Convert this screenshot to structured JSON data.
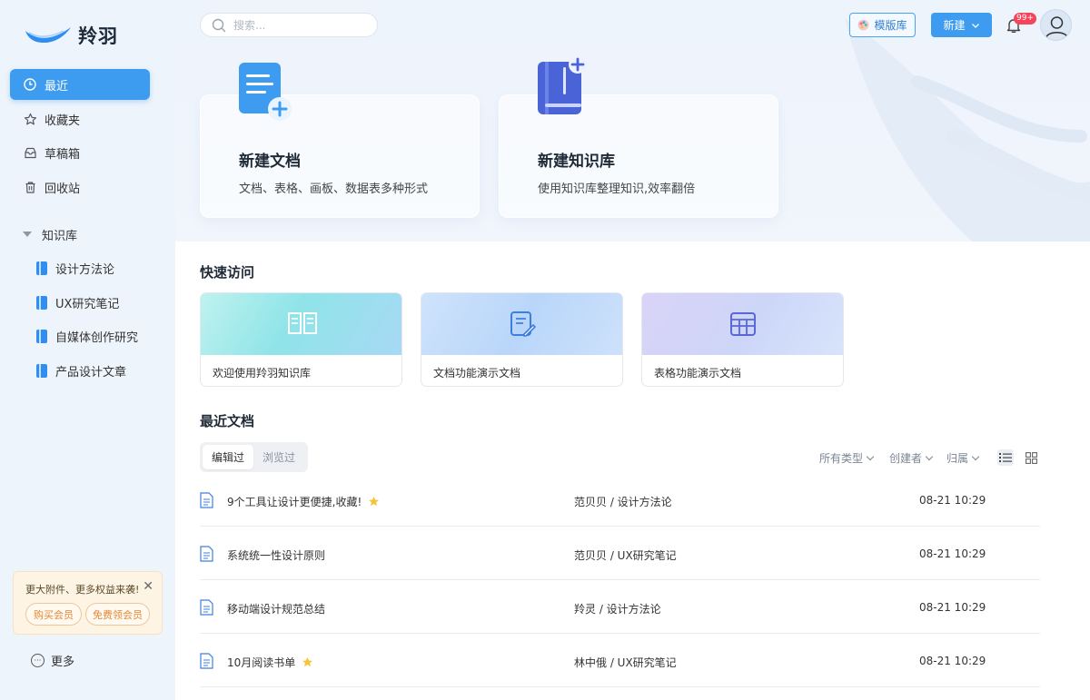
{
  "app": {
    "name": "羚羽"
  },
  "sidebar": {
    "nav": [
      {
        "label": "最近",
        "icon": "clock-icon",
        "active": true
      },
      {
        "label": "收藏夹",
        "icon": "star-outline-icon"
      },
      {
        "label": "草稿箱",
        "icon": "inbox-icon"
      },
      {
        "label": "回收站",
        "icon": "trash-icon"
      }
    ],
    "kb_header": "知识库",
    "kb_items": [
      "设计方法论",
      "UX研究笔记",
      "自媒体创作研究",
      "产品设计文章"
    ],
    "promo": {
      "text": "更大附件、更多权益来袭!",
      "buy": "购买会员",
      "free": "免费领会员"
    },
    "more": "更多"
  },
  "header": {
    "search_placeholder": "搜索...",
    "templates_label": "模版库",
    "new_label": "新建",
    "notification_badge": "99+"
  },
  "create_cards": [
    {
      "title": "新建文档",
      "subtitle": "文档、表格、画板、数据表多种形式"
    },
    {
      "title": "新建知识库",
      "subtitle": "使用知识库整理知识,效率翻倍"
    }
  ],
  "quick_access": {
    "title": "快速访问",
    "items": [
      {
        "label": "欢迎使用羚羽知识库",
        "icon": "book-open-icon"
      },
      {
        "label": "文档功能演示文档",
        "icon": "doc-edit-icon"
      },
      {
        "label": "表格功能演示文档",
        "icon": "table-icon"
      }
    ]
  },
  "recent": {
    "title": "最近文档",
    "tabs": [
      "编辑过",
      "浏览过"
    ],
    "filters": [
      "所有类型",
      "创建者",
      "归属"
    ],
    "rows": [
      {
        "name": "9个工具让设计更便捷,收藏!",
        "starred": true,
        "location": "范贝贝 / 设计方法论",
        "time": "08-21 10:29"
      },
      {
        "name": "系统统一性设计原则",
        "starred": false,
        "location": "范贝贝 / UX研究笔记",
        "time": "08-21 10:29"
      },
      {
        "name": "移动端设计规范总结",
        "starred": false,
        "location": "羚灵 / 设计方法论",
        "time": "08-21 10:29"
      },
      {
        "name": "10月阅读书单",
        "starred": true,
        "location": "林中俄 / UX研究笔记",
        "time": "08-21 10:29"
      }
    ]
  },
  "colors": {
    "accent": "#3d9bf0",
    "sidebar_bg": "#eef4fb",
    "star": "#f5c43a"
  }
}
